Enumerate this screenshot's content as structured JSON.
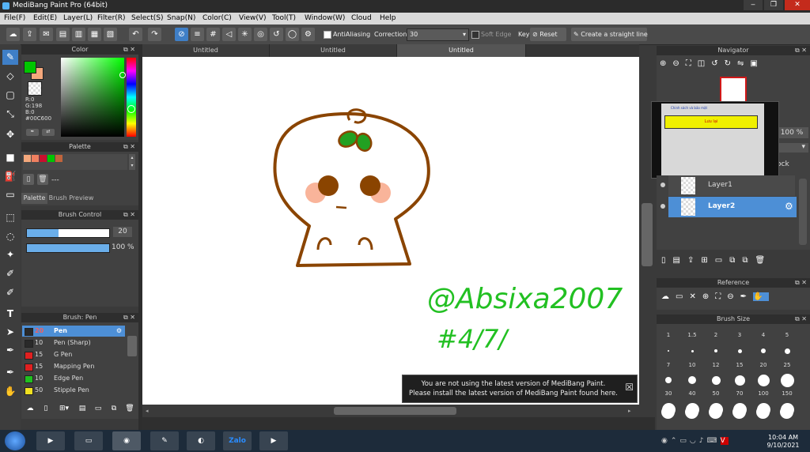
{
  "window": {
    "title": "MediBang Paint Pro (64bit)"
  },
  "menu": [
    "File(F)",
    "Edit(E)",
    "Layer(L)",
    "Filter(R)",
    "Select(S)",
    "Snap(N)",
    "Color(C)",
    "View(V)",
    "Tool(T)",
    "Window(W)",
    "Cloud",
    "Help"
  ],
  "toolbar": {
    "antialiasing_label": "AntiAliasing",
    "antialiasing_checked": true,
    "correction_label": "Correction",
    "correction_value": "30",
    "soft_edge_label": "Soft Edge",
    "soft_edge_checked": false,
    "key_label": "Key",
    "reset_label": "Reset",
    "straight_line_label": "Create a straight line"
  },
  "color_panel": {
    "title": "Color",
    "r": "R:0",
    "g": "G:198",
    "b": "B:0",
    "hex": "#00C600",
    "primary": "#00c600",
    "secondary": "#f4a87c"
  },
  "palette_panel": {
    "title": "Palette",
    "swatches": [
      "#f4a87c",
      "#f08060",
      "#c8102e",
      "#00c600",
      "#c0643c"
    ],
    "dash": "---",
    "tabs": [
      "Palette",
      "Brush Preview"
    ]
  },
  "brush_control": {
    "title": "Brush Control",
    "size": "20",
    "opacity": "100 %",
    "size_fraction": 0.38,
    "opacity_fraction": 1.0
  },
  "brush_panel": {
    "title": "Brush: Pen",
    "items": [
      {
        "size": "20",
        "name": "Pen",
        "color": "#2a2a2a",
        "selected": true
      },
      {
        "size": "10",
        "name": "Pen (Sharp)",
        "color": "#2a2a2a",
        "selected": false
      },
      {
        "size": "15",
        "name": "G Pen",
        "color": "#e02020",
        "selected": false
      },
      {
        "size": "15",
        "name": "Mapping Pen",
        "color": "#e02020",
        "selected": false
      },
      {
        "size": "10",
        "name": "Edge Pen",
        "color": "#20c020",
        "selected": false
      },
      {
        "size": "50",
        "name": "Stipple Pen",
        "color": "#f0e020",
        "selected": false
      }
    ]
  },
  "canvas_tabs": [
    "Untitled",
    "Untitled",
    "Untitled"
  ],
  "canvas": {
    "handwriting_line1": "@Absixa2007",
    "handwriting_line2": "#4/7/",
    "notice_line1": "You are not using the latest version of MediBang Paint.",
    "notice_line2": "Please install the latest version of MediBang Paint found here.",
    "notice_close": "☒"
  },
  "navigator": {
    "title": "Navigator"
  },
  "popup": {
    "top_text": "Chinh sách và bảo mật",
    "button_text": "Lưu lại"
  },
  "layers": {
    "opacity": "100 %",
    "lock_label": "ock",
    "items": [
      {
        "name": "Layer1",
        "selected": false
      },
      {
        "name": "Layer2",
        "selected": true
      }
    ]
  },
  "reference": {
    "title": "Reference"
  },
  "brush_size": {
    "title": "Brush Size",
    "row1": [
      "1",
      "1.5",
      "2",
      "3",
      "4",
      "5"
    ],
    "row2": [
      "7",
      "10",
      "12",
      "15",
      "20",
      "25"
    ],
    "row3": [
      "30",
      "40",
      "50",
      "70",
      "100",
      "150"
    ]
  },
  "taskbar": {
    "time": "10:04 AM",
    "date": "9/10/2021",
    "zalo": "Zalo"
  }
}
